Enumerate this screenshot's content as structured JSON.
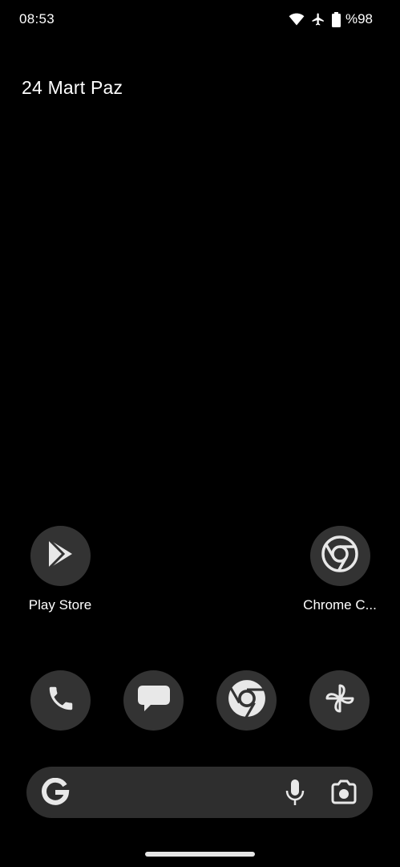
{
  "status_bar": {
    "time": "08:53",
    "battery_percent": "%98",
    "icons": [
      "wifi-icon",
      "airplane-mode-icon",
      "battery-icon"
    ]
  },
  "date_widget": {
    "text": "24 Mart Paz"
  },
  "home_apps": [
    {
      "label": "Play Store",
      "icon": "play-store-icon"
    },
    {
      "label": "Chrome C...",
      "icon": "chrome-icon"
    }
  ],
  "dock": [
    {
      "app": "phone",
      "icon": "phone-icon"
    },
    {
      "app": "messages",
      "icon": "messages-icon"
    },
    {
      "app": "chrome",
      "icon": "chrome-icon"
    },
    {
      "app": "photos",
      "icon": "photos-pinwheel-icon"
    }
  ],
  "search_bar": {
    "icons": [
      "google-g-icon",
      "mic-icon",
      "google-lens-icon"
    ]
  },
  "colors": {
    "background": "#000000",
    "icon_circle": "#333333",
    "search_bar": "#2e2e2e",
    "icon_glyph": "#e8e8e8",
    "text": "#ffffff"
  }
}
